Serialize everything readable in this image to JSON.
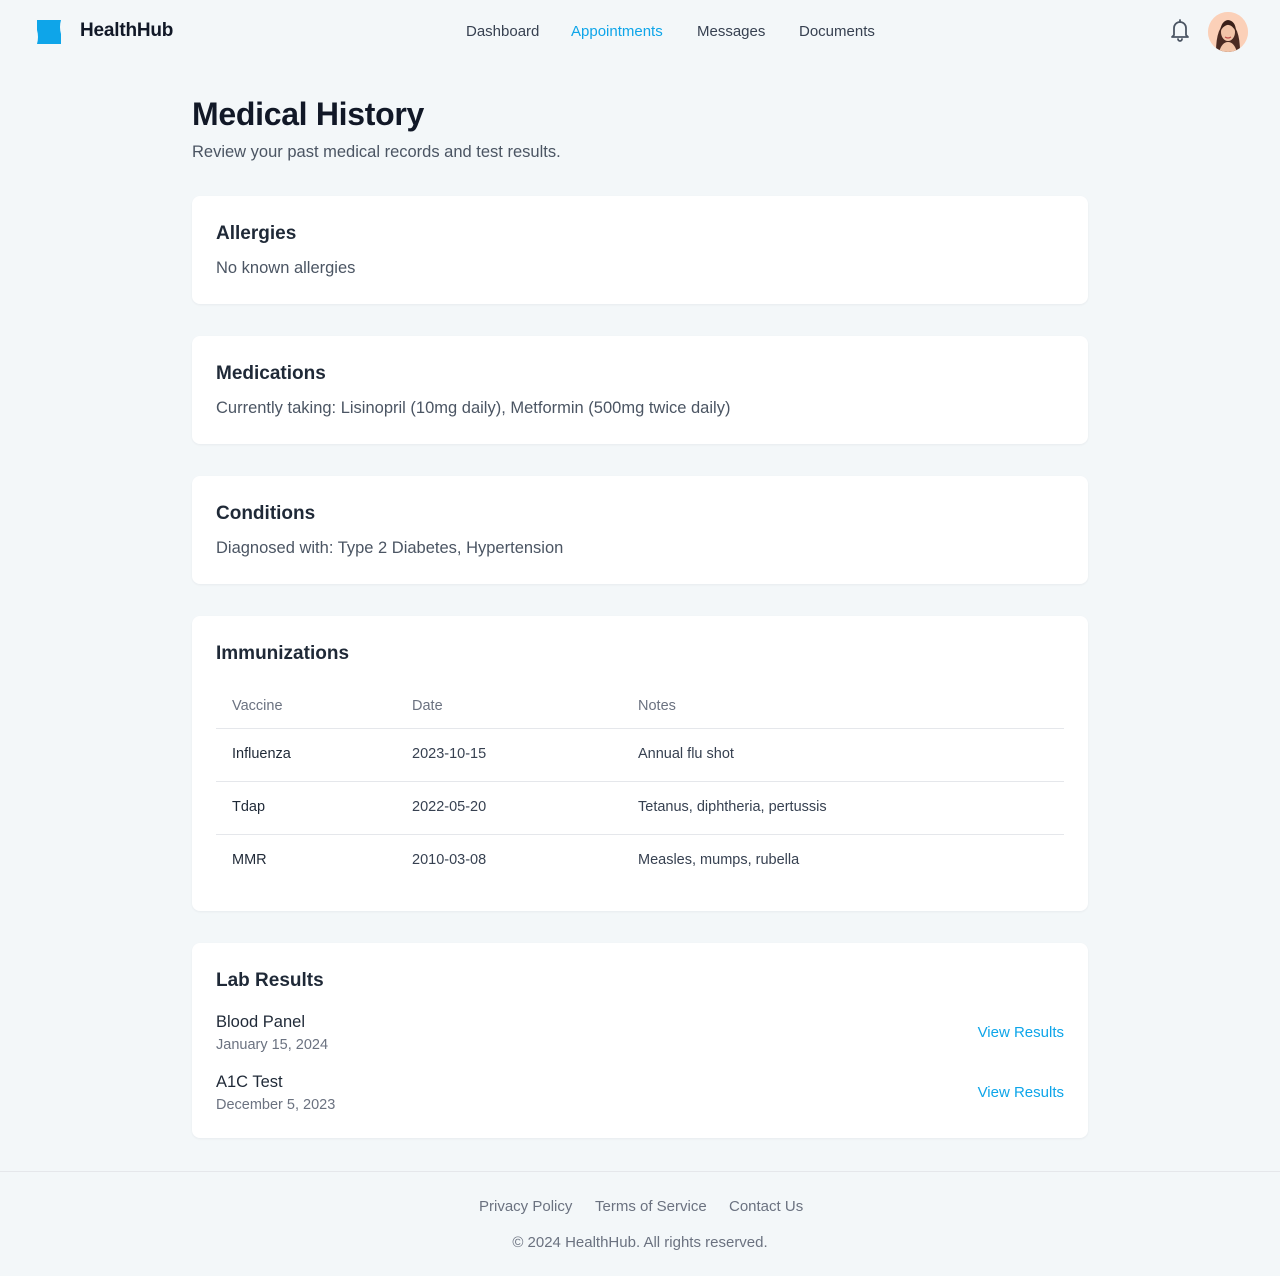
{
  "app": {
    "name": "HealthHub"
  },
  "nav": {
    "items": [
      {
        "label": "Dashboard",
        "active": false
      },
      {
        "label": "Appointments",
        "active": true
      },
      {
        "label": "Messages",
        "active": false
      },
      {
        "label": "Documents",
        "active": false
      }
    ]
  },
  "header_icons": {
    "notifications": "bell-icon",
    "avatar": "user-avatar"
  },
  "page": {
    "title": "Medical History",
    "subtitle": "Review your past medical records and test results."
  },
  "allergies": {
    "title": "Allergies",
    "text": "No known allergies"
  },
  "medications": {
    "title": "Medications",
    "text": "Currently taking: Lisinopril (10mg daily), Metformin (500mg twice daily)"
  },
  "conditions": {
    "title": "Conditions",
    "text": "Diagnosed with: Type 2 Diabetes, Hypertension"
  },
  "immunizations": {
    "title": "Immunizations",
    "columns": [
      "Vaccine",
      "Date",
      "Notes"
    ],
    "rows": [
      [
        "Influenza",
        "2023-10-15",
        "Annual flu shot"
      ],
      [
        "Tdap",
        "2022-05-20",
        "Tetanus, diphtheria, pertussis"
      ],
      [
        "MMR",
        "2010-03-08",
        "Measles, mumps, rubella"
      ]
    ]
  },
  "lab_results": {
    "title": "Lab Results",
    "items": [
      {
        "name": "Blood Panel",
        "date": "January 15, 2024",
        "action": "View Results"
      },
      {
        "name": "A1C Test",
        "date": "December 5, 2023",
        "action": "View Results"
      }
    ]
  },
  "footer": {
    "links": [
      "Privacy Policy",
      "Terms of Service",
      "Contact Us"
    ],
    "copyright": "© 2024 HealthHub. All rights reserved."
  },
  "colors": {
    "accent": "#0ea5e9",
    "background": "#f3f7f9",
    "card": "#ffffff",
    "text_primary": "#111827",
    "text_secondary": "#4b5563"
  }
}
